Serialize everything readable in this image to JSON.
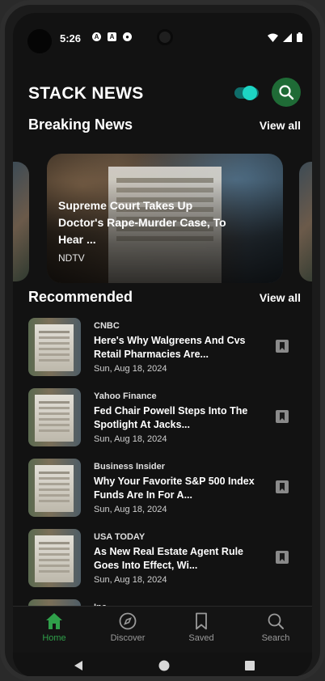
{
  "status_bar": {
    "time": "5:26",
    "icons": [
      "A",
      "A",
      "●"
    ]
  },
  "header": {
    "title": "STACK NEWS"
  },
  "breaking": {
    "section_title": "Breaking News",
    "view_all": "View all",
    "card": {
      "headline": "Supreme Court Takes Up Doctor's Rape-Murder Case, To Hear ...",
      "source": "NDTV"
    }
  },
  "recommended": {
    "section_title": "Recommended",
    "view_all": "View all",
    "items": [
      {
        "source": "CNBC",
        "title": "Here's Why Walgreens And Cvs Retail Pharmacies Are...",
        "date": "Sun, Aug 18, 2024"
      },
      {
        "source": "Yahoo Finance",
        "title": "Fed Chair Powell Steps Into The Spotlight At Jacks...",
        "date": "Sun, Aug 18, 2024"
      },
      {
        "source": "Business Insider",
        "title": "Why Your Favorite S&P 500 Index Funds Are In For A...",
        "date": "Sun, Aug 18, 2024"
      },
      {
        "source": "USA TODAY",
        "title": "As New Real Estate Agent Rule Goes Into Effect, Wi...",
        "date": "Sun, Aug 18, 2024"
      },
      {
        "source": "Inc",
        "title": "",
        "date": ""
      }
    ]
  },
  "bottom_nav": {
    "items": [
      {
        "label": "Home",
        "icon": "home-icon",
        "active": true
      },
      {
        "label": "Discover",
        "icon": "compass-icon",
        "active": false
      },
      {
        "label": "Saved",
        "icon": "bookmark-icon",
        "active": false
      },
      {
        "label": "Search",
        "icon": "search-icon",
        "active": false
      }
    ]
  },
  "colors": {
    "accent": "#2fa04a",
    "toggle": "#1dd5c4",
    "background": "#121212"
  }
}
